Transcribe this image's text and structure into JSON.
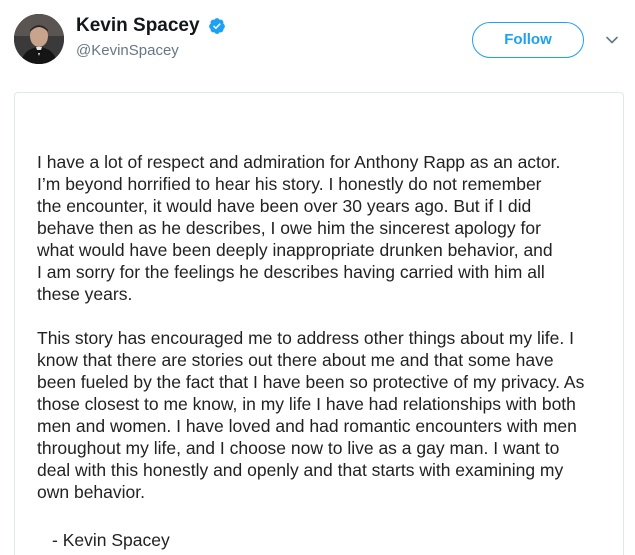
{
  "user": {
    "display_name": "Kevin Spacey",
    "handle": "@KevinSpacey",
    "verified": true
  },
  "actions": {
    "follow_label": "Follow",
    "more_icon": "chevron-down-icon"
  },
  "colors": {
    "accent": "#1da1f2",
    "name": "#14171a",
    "handle": "#657786",
    "verified": "#1da1f2"
  },
  "statement": {
    "paragraph1": [
      "I have a lot of respect and admiration for Anthony Rapp as an actor.",
      "I’m beyond horrified to hear his story. I honestly do not remember",
      "the encounter, it would have been over 30 years ago. But if I did",
      "behave then as he describes, I owe him the sincerest apology for",
      "what would have been deeply inappropriate drunken behavior, and",
      "I am sorry for the feelings he describes having carried with him all",
      "these years."
    ],
    "paragraph2": [
      "This story has encouraged me to address other things about my life. I",
      "know that there are stories out there about me and that some have",
      "been fueled by the fact that I have been so protective of my privacy. As",
      "those closest to me know, in my life I have had relationships with both",
      "men and women. I have loved and had romantic encounters with men",
      "throughout my life, and I choose now to live as a gay man.  I want to",
      "deal with this honestly and openly and that starts with examining my",
      "own behavior."
    ],
    "signature": "- Kevin Spacey"
  }
}
